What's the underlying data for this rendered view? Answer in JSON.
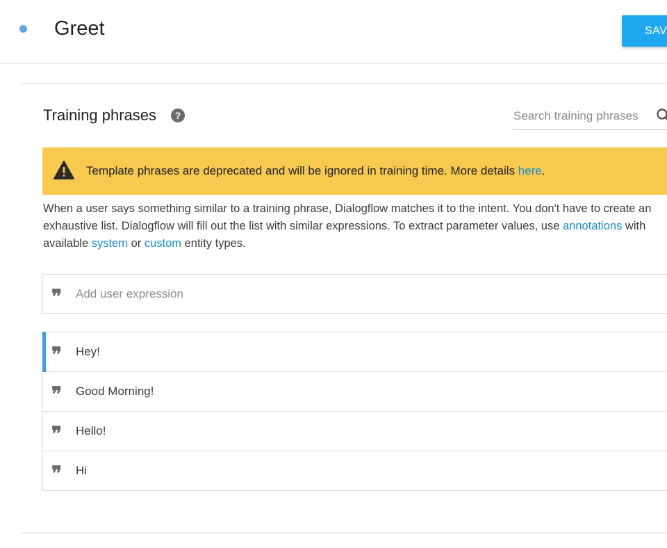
{
  "header": {
    "intent_title": "Greet",
    "save_label": "SAVE",
    "status_color": "#5ba6e0",
    "accent_color": "#1ea8f0"
  },
  "training": {
    "title": "Training phrases",
    "help_icon": "question-circle-icon",
    "search_placeholder": "Search training phrases",
    "search_icon": "search-icon"
  },
  "warning": {
    "icon": "warning-triangle-icon",
    "text_prefix": "Template phrases are deprecated and will be ignored in training time. More details ",
    "link_text": "here",
    "text_suffix": ".",
    "background_color": "#f7c94f"
  },
  "description": {
    "line1": "When a user says something similar to a training phrase, Dialogflow matches it to the intent. You don't have to create an",
    "line2_prefix": "exhaustive list. Dialogflow will fill out the list with similar expressions. To extract parameter values, use ",
    "line2_link": "annotations",
    "line2_suffix": " with",
    "line3_prefix": "available ",
    "line3_link1": "system",
    "line3_middle": " or ",
    "line3_link2": "custom",
    "line3_suffix": " entity types."
  },
  "add_expression": {
    "placeholder": "Add user expression",
    "quote_glyph": "❞",
    "icon": "quote-icon"
  },
  "phrases": [
    {
      "text": "Hey!",
      "selected": true
    },
    {
      "text": "Good Morning!",
      "selected": false
    },
    {
      "text": "Hello!",
      "selected": false
    },
    {
      "text": "Hi",
      "selected": false
    }
  ]
}
